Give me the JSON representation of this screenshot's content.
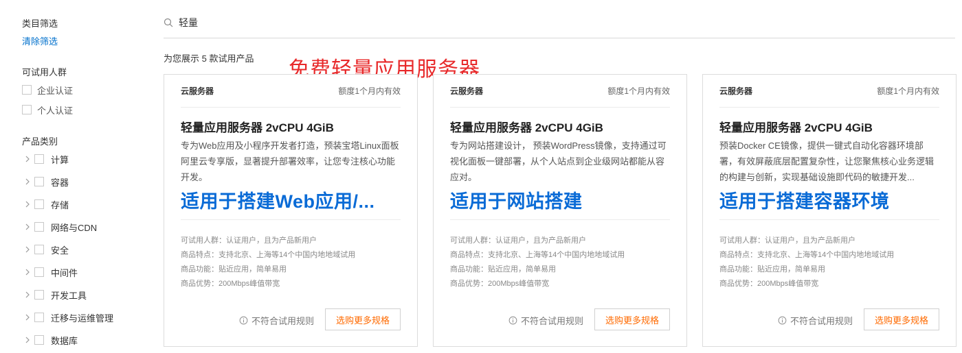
{
  "sidebar": {
    "category_filter_title": "类目筛选",
    "clear_filter": "清除筛选",
    "audience_title": "可试用人群",
    "audience": [
      "企业认证",
      "个人认证"
    ],
    "product_category_title": "产品类别",
    "categories": [
      "计算",
      "容器",
      "存储",
      "网络与CDN",
      "安全",
      "中间件",
      "开发工具",
      "迁移与运维管理",
      "数据库"
    ]
  },
  "search": {
    "value": "轻量",
    "icon": "search-icon"
  },
  "result_count": "为您展示 5 款试用产品",
  "promo_text": "免费轻量应用服务器",
  "cards": [
    {
      "category": "云服务器",
      "validity": "额度1个月内有效",
      "title": "轻量应用服务器 2vCPU 4GiB",
      "description": "专为Web应用及小程序开发者打造，预装宝塔Linux面板阿里云专享版，显著提升部署效率，让您专注核心功能开发。",
      "overlay": "适用于搭建Web应用/...",
      "attributes": [
        "可试用人群：认证用户，且为产品新用户",
        "商品特点：支持北京、上海等14个中国内地地域试用",
        "商品功能：贴近应用，简单易用",
        "商品优势：200Mbps峰值带宽"
      ],
      "rule_label": "不符合试用规则",
      "buy_label": "选购更多规格"
    },
    {
      "category": "云服务器",
      "validity": "额度1个月内有效",
      "title": "轻量应用服务器 2vCPU 4GiB",
      "description": "专为网站搭建设计， 预装WordPress镜像，支持通过可视化面板一键部署，从个人站点到企业级网站都能从容应对。",
      "overlay": "适用于网站搭建",
      "attributes": [
        "可试用人群：认证用户，且为产品新用户",
        "商品特点：支持北京、上海等14个中国内地地域试用",
        "商品功能：贴近应用，简单易用",
        "商品优势：200Mbps峰值带宽"
      ],
      "rule_label": "不符合试用规则",
      "buy_label": "选购更多规格"
    },
    {
      "category": "云服务器",
      "validity": "额度1个月内有效",
      "title": "轻量应用服务器 2vCPU 4GiB",
      "description": "预装Docker CE镜像，提供一键式自动化容器环境部署，有效屏蔽底层配置复杂性，让您聚焦核心业务逻辑的构建与创新，实现基础设施即代码的敏捷开发...",
      "overlay": "适用于搭建容器环境",
      "attributes": [
        "可试用人群：认证用户，且为产品新用户",
        "商品特点：支持北京、上海等14个中国内地地域试用",
        "商品功能：贴近应用，简单易用",
        "商品优势：200Mbps峰值带宽"
      ],
      "rule_label": "不符合试用规则",
      "buy_label": "选购更多规格"
    }
  ],
  "colors": {
    "link": "#0070cc",
    "promo": "#e8292a",
    "overlay": "#0a6bd6",
    "button_text": "#ff6a00"
  }
}
